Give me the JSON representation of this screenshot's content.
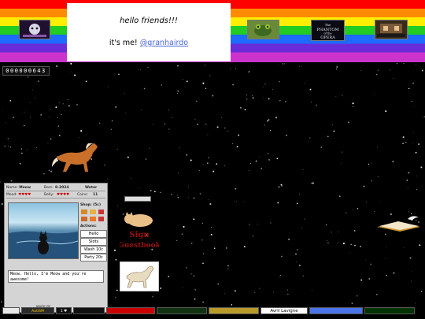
{
  "header": {
    "greeting": "hello friends!!!",
    "intro_prefix": "it's me! ",
    "handle": "@granhairdo"
  },
  "header_stamps": [
    {
      "icon": "phantom-stamp-icon",
      "bg": "#201030"
    },
    {
      "icon": "frog-stamp-icon",
      "bg": "#6a8a3a"
    },
    {
      "icon": "phantom-of-the-opera-stamp-icon",
      "bg": "#0a0a14",
      "text": "The PHANTOM of the OPERA"
    },
    {
      "icon": "cafe-stamp-icon",
      "bg": "#3a2a1a"
    }
  ],
  "visitor_counter": "000000643",
  "pet": {
    "name_label": "Name:",
    "name": "Meow",
    "born_label": "Born:",
    "born": "8-2024",
    "type": "Water",
    "mood_label": "Mood:",
    "mood": "♥♥♥♥",
    "belly_label": "Belly:",
    "belly": "♥♥♥♥",
    "coins_label": "Coins:",
    "coins": "11",
    "shop_label": "Shop: (5c)",
    "actions_label": "Actions:",
    "actions": [
      "Hello",
      "Slots",
      "Wash 10c",
      "Party 20c"
    ],
    "message": "Meow. Hello, I'm Meow and you're awesome!",
    "footer": "MADE BY"
  },
  "guestbook": {
    "line1": "Sign",
    "line2": "Guestbook"
  },
  "bottom_badges": [
    {
      "icon": "globe-badge-icon",
      "bg": "#e8e8e8",
      "color": "#000"
    },
    {
      "icon": "autism-badge-icon",
      "bg": "#2a2a2a",
      "color": "#ffcc00",
      "text": "AutiSM"
    },
    {
      "icon": "heart-badge-icon",
      "bg": "#111",
      "color": "#fff",
      "text": "1 ♥"
    },
    {
      "icon": "badge-icon",
      "bg": "#111",
      "color": "#aaa"
    },
    {
      "icon": "red-badge-icon",
      "bg": "#cc0000",
      "color": "#fff"
    },
    {
      "icon": "green-badge-icon",
      "bg": "#113311",
      "color": "#00ff66"
    },
    {
      "icon": "gold-badge-icon",
      "bg": "#b89a2a",
      "color": "#fff"
    },
    {
      "icon": "avril-lavigne-badge-icon",
      "bg": "#ffffff",
      "color": "#000",
      "text": "Avril Lavigne"
    },
    {
      "icon": "blue-badge-icon",
      "bg": "#4a74e8",
      "color": "#fff"
    },
    {
      "icon": "alien-badge-icon",
      "bg": "#003300",
      "color": "#66ff66"
    }
  ]
}
